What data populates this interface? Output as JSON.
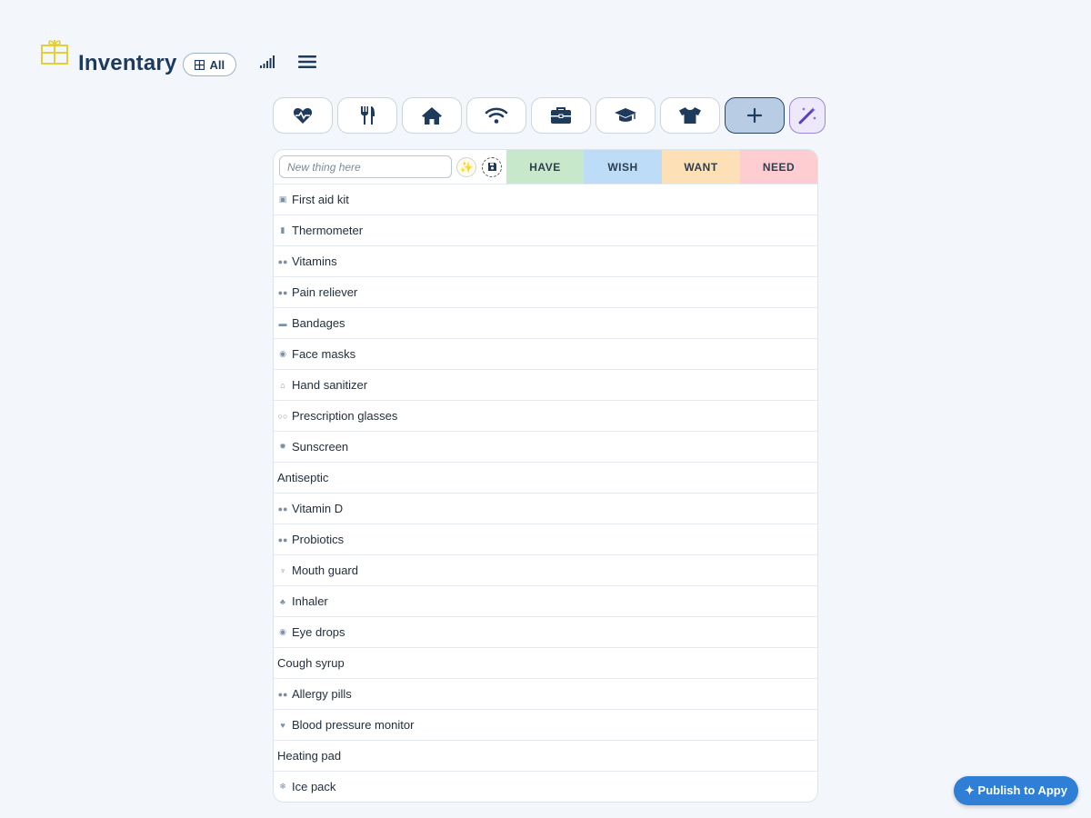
{
  "app": {
    "title": "Inventary",
    "filter_label": "All"
  },
  "categories": [
    {
      "name": "health",
      "icon": "heart-pulse-icon"
    },
    {
      "name": "food",
      "icon": "utensils-icon"
    },
    {
      "name": "home",
      "icon": "home-icon"
    },
    {
      "name": "tech",
      "icon": "wifi-icon"
    },
    {
      "name": "work",
      "icon": "briefcase-icon"
    },
    {
      "name": "education",
      "icon": "graduation-cap-icon"
    },
    {
      "name": "clothing",
      "icon": "tshirt-icon"
    },
    {
      "name": "add",
      "icon": "plus-icon"
    },
    {
      "name": "magic",
      "icon": "magic-wand-icon"
    }
  ],
  "table": {
    "new_placeholder": "New thing here",
    "columns": [
      "HAVE",
      "WISH",
      "WANT",
      "NEED"
    ],
    "colors": {
      "have": "#c8e8cc",
      "wish": "#bcdcf8",
      "want": "#fde0b6",
      "need": "#fdcdd2"
    },
    "items": [
      {
        "label": "First aid kit",
        "icon": "medkit-icon",
        "glyph": "▣"
      },
      {
        "label": "Thermometer",
        "icon": "thermometer-icon",
        "glyph": "▮"
      },
      {
        "label": "Vitamins",
        "icon": "pills-icon",
        "glyph": "●●"
      },
      {
        "label": "Pain reliever",
        "icon": "pills-icon",
        "glyph": "●●"
      },
      {
        "label": "Bandages",
        "icon": "bandage-icon",
        "glyph": "▬"
      },
      {
        "label": "Face masks",
        "icon": "mask-icon",
        "glyph": "◉"
      },
      {
        "label": "Hand sanitizer",
        "icon": "pump-bottle-icon",
        "glyph": "⌂"
      },
      {
        "label": "Prescription glasses",
        "icon": "glasses-icon",
        "glyph": "○○"
      },
      {
        "label": "Sunscreen",
        "icon": "sun-icon",
        "glyph": "✹"
      },
      {
        "label": "Antiseptic",
        "icon": "",
        "glyph": ""
      },
      {
        "label": "Vitamin D",
        "icon": "pills-icon",
        "glyph": "●●"
      },
      {
        "label": "Probiotics",
        "icon": "pills-icon",
        "glyph": "●●"
      },
      {
        "label": "Mouth guard",
        "icon": "tooth-icon",
        "glyph": "♆"
      },
      {
        "label": "Inhaler",
        "icon": "lungs-icon",
        "glyph": "♣"
      },
      {
        "label": "Eye drops",
        "icon": "eye-icon",
        "glyph": "◉"
      },
      {
        "label": "Cough syrup",
        "icon": "",
        "glyph": ""
      },
      {
        "label": "Allergy pills",
        "icon": "pills-icon",
        "glyph": "●●"
      },
      {
        "label": "Blood pressure monitor",
        "icon": "heart-icon",
        "glyph": "♥"
      },
      {
        "label": "Heating pad",
        "icon": "",
        "glyph": ""
      },
      {
        "label": "Ice pack",
        "icon": "snowflake-icon",
        "glyph": "❄"
      }
    ]
  },
  "publish": {
    "label": "✦ Publish to Appy"
  }
}
